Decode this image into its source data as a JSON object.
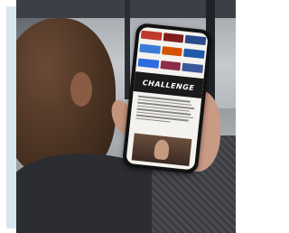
{
  "photo": {
    "subject": "person-holding-smartphone",
    "panel_color": "#d8e6ef"
  },
  "phone_screen": {
    "banner_text": "CHALLENGE",
    "banner_badge": "",
    "heading": "",
    "logos": [
      {
        "color": "#c0392b"
      },
      {
        "color": "#7f1d1d"
      },
      {
        "color": "#2b4a8b"
      },
      {
        "color": "#3a7bd5"
      },
      {
        "color": "#d35400"
      },
      {
        "color": "#1e5aa8"
      },
      {
        "color": "#2d6cdf"
      },
      {
        "color": "#8e2c4c"
      },
      {
        "color": "#3b5998"
      }
    ],
    "text_line_count": 8
  }
}
